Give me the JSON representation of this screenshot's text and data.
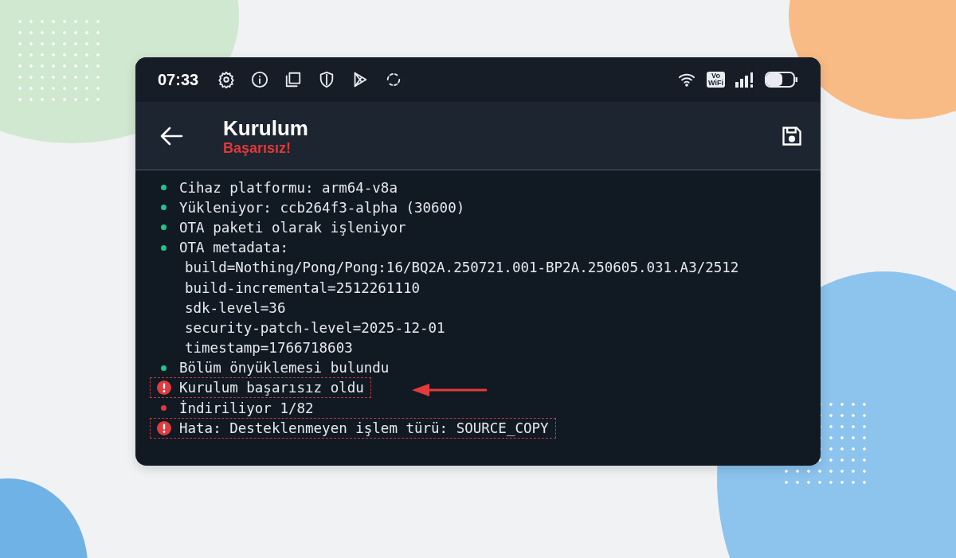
{
  "status_bar": {
    "time": "07:33",
    "wifi_badge_top": "Vo",
    "wifi_badge_bottom": "WiFi"
  },
  "header": {
    "title": "Kurulum",
    "subtitle": "Başarısız!"
  },
  "log": [
    {
      "kind": "success",
      "text": "Cihaz platformu: arm64-v8a",
      "highlighted": false
    },
    {
      "kind": "success",
      "text": "Yükleniyor: ccb264f3-alpha (30600)",
      "highlighted": false
    },
    {
      "kind": "success",
      "text": "OTA paketi olarak işleniyor",
      "highlighted": false
    },
    {
      "kind": "success",
      "text": "OTA metadata:",
      "highlighted": false
    },
    {
      "kind": "detail",
      "text": "build=Nothing/Pong/Pong:16/BQ2A.250721.001-BP2A.250605.031.A3/2512",
      "highlighted": false
    },
    {
      "kind": "detail",
      "text": "build-incremental=2512261110",
      "highlighted": false
    },
    {
      "kind": "detail",
      "text": "sdk-level=36",
      "highlighted": false
    },
    {
      "kind": "detail",
      "text": "security-patch-level=2025-12-01",
      "highlighted": false
    },
    {
      "kind": "detail",
      "text": "timestamp=1766718603",
      "highlighted": false
    },
    {
      "kind": "success",
      "text": "Bölüm önyüklemesi bulundu",
      "highlighted": false
    },
    {
      "kind": "error",
      "text": "Kurulum başarısız oldu",
      "highlighted": true
    },
    {
      "kind": "warning",
      "text": "İndiriliyor 1/82",
      "highlighted": false
    },
    {
      "kind": "error",
      "text": "Hata: Desteklenmeyen işlem türü: SOURCE_COPY",
      "highlighted": true
    }
  ]
}
